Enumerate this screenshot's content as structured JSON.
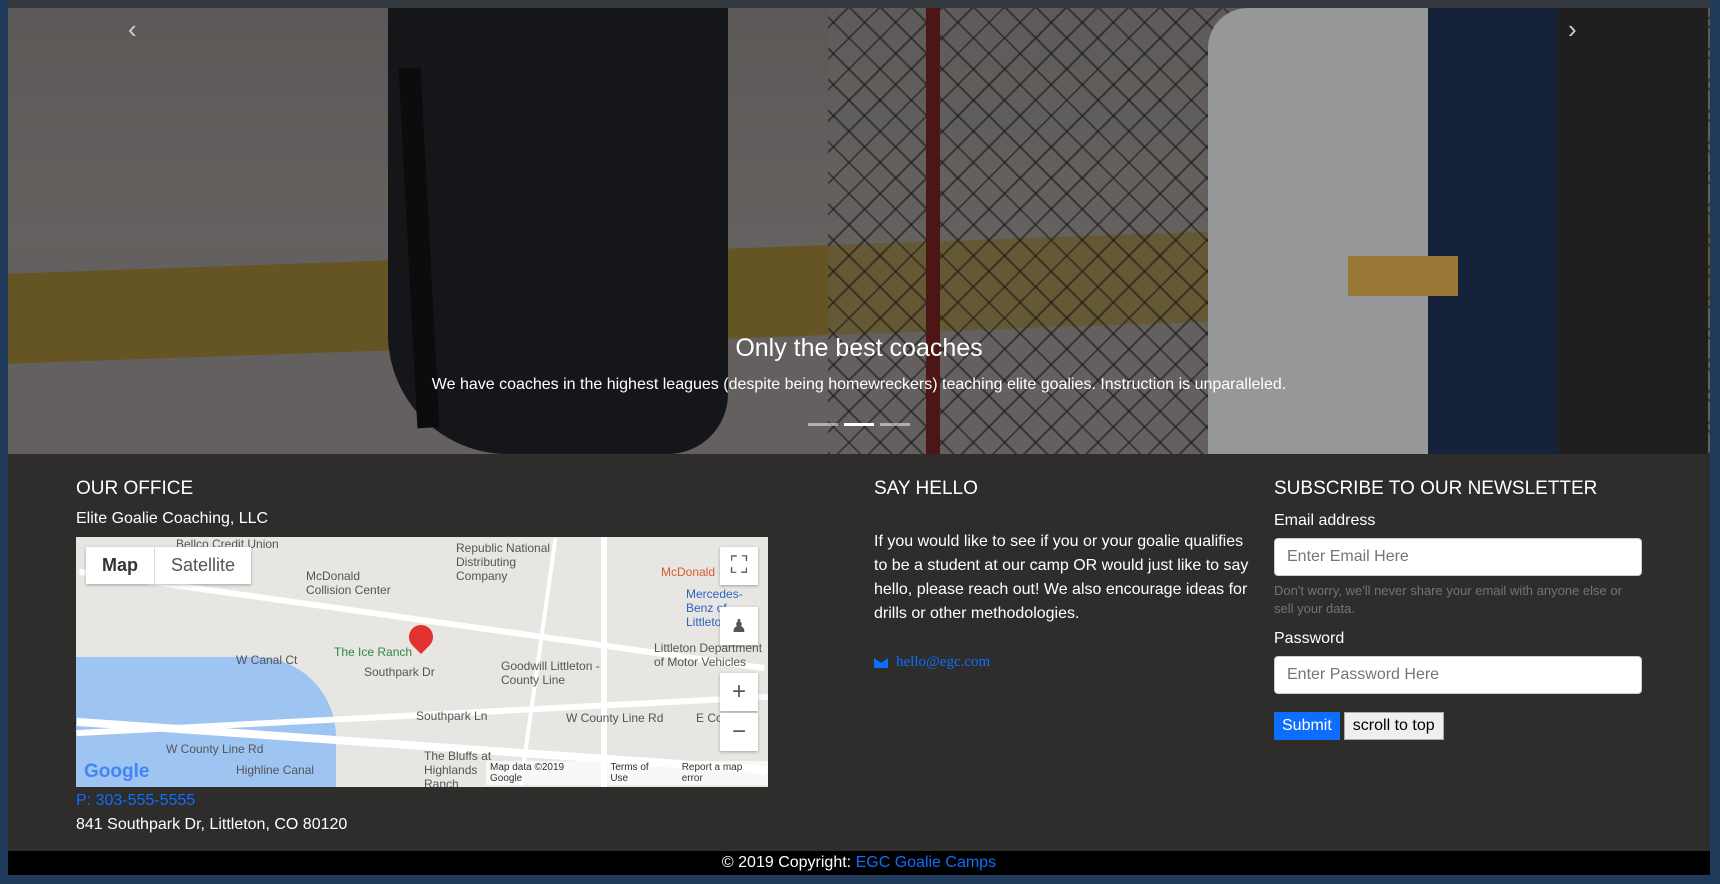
{
  "carousel": {
    "prev_icon": "‹",
    "next_icon": "›",
    "slide_title": "Only the best coaches",
    "slide_text": "We have coaches in the highest leagues (despite being homewreckers) teaching elite goalies. Instruction is unparalleled.",
    "indicator_count": 3,
    "active_index": 1
  },
  "office": {
    "heading": "OUR OFFICE",
    "company": "Elite Goalie Coaching, LLC",
    "phone": "P: 303-555-5555",
    "address": "841 Southpark Dr, Littleton, CO 80120",
    "map": {
      "type_map": "Map",
      "type_satellite": "Satellite",
      "labels": {
        "bellco": "Bellco Credit Union",
        "republic": "Republic National Distributing Company",
        "mcdonald_collision": "McDonald Collision Center",
        "mcdonalds": "McDonald",
        "mercedes": "Mercedes-Benz of Littleton",
        "ice_ranch": "The Ice Ranch",
        "southpark": "Southpark Dr",
        "goodwill": "Goodwill Littleton - County Line",
        "dmv": "Littleton Department of Motor Vehicles",
        "southpark_ln": "Southpark Ln",
        "county_line": "W County Line Rd",
        "e_county": "E County",
        "bluffs": "The Bluffs at Highlands Ranch",
        "w_canal": "W Canal Ct",
        "highline": "Highline Canal",
        "w_county_line_2": "W County Line Rd"
      },
      "zoom_in": "+",
      "zoom_out": "−",
      "fullscreen_icon": "⛶",
      "google": "Google",
      "map_data": "Map data ©2019 Google",
      "terms": "Terms of Use",
      "report": "Report a map error"
    }
  },
  "hello": {
    "heading": "SAY HELLO",
    "text": "If you would like to see if you or your goalie qualifies to be a student at our camp OR would just like to say hello, please reach out! We also encourage ideas for drills or other methodologies.",
    "email": "hello@egc.com"
  },
  "subscribe": {
    "heading": "SUBSCRIBE TO OUR NEWSLETTER",
    "email_label": "Email address",
    "email_placeholder": "Enter Email Here",
    "help": "Don't worry, we'll never share your email with anyone else or sell your data.",
    "password_label": "Password",
    "password_placeholder": "Enter Password Here",
    "submit": "Submit",
    "scroll_top": "scroll to top"
  },
  "footer": {
    "copyright": "© 2019 Copyright:",
    "link": "EGC Goalie Camps"
  }
}
